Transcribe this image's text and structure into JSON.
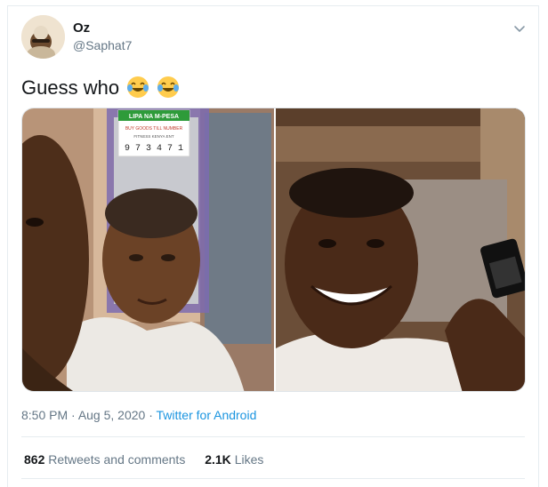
{
  "author": {
    "name": "Oz",
    "handle": "@Saphat7",
    "avatar_icon": "profile-photo-avatar"
  },
  "menu_icon": "chevron-down-icon",
  "tweet": {
    "text": "Guess who",
    "emojis": [
      "face-with-tears-of-joy",
      "face-with-tears-of-joy"
    ]
  },
  "media": {
    "left_photo_sign": {
      "line1": "LIPA NA M-PESA",
      "line2": "BUY GOODS TILL NUMBER",
      "line3": "FITNESS KENYA ENT",
      "digits": "9 7 3 4 7 1"
    }
  },
  "meta": {
    "time": "8:50 PM",
    "sep1": " · ",
    "date": "Aug 5, 2020",
    "sep2": " · ",
    "source": "Twitter for Android"
  },
  "stats": {
    "retweets_count": "862",
    "retweets_label": "Retweets and comments",
    "likes_count": "2.1K",
    "likes_label": "Likes"
  },
  "colors": {
    "link": "#1b95e0",
    "secondary_text": "#657786",
    "primary_text": "#14171a"
  }
}
